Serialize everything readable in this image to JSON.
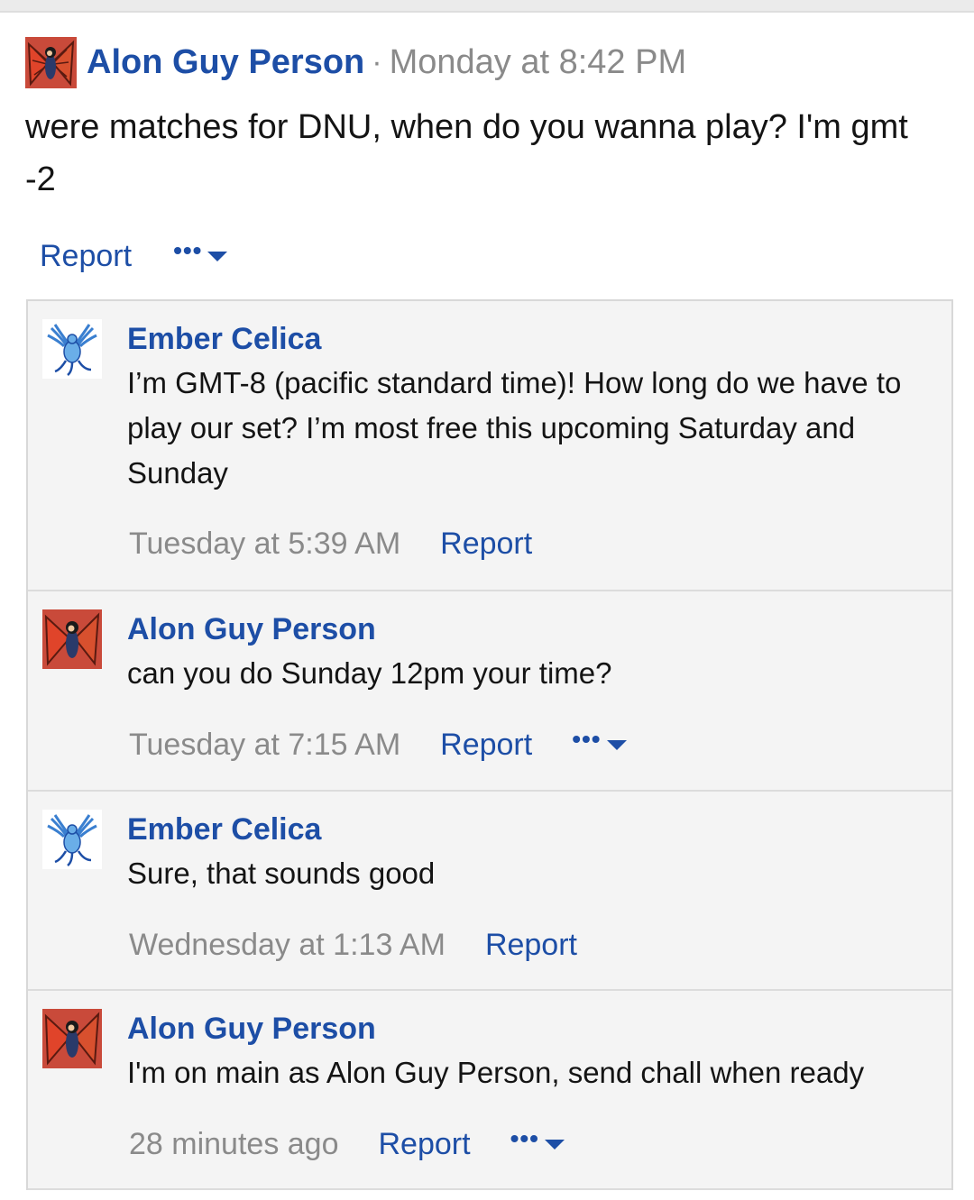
{
  "post": {
    "author": "Alon Guy Person",
    "separator": "·",
    "time": "Monday at 8:42 PM",
    "body": "were matches for DNU, when do you wanna play? I'm gmt -2",
    "report_label": "Report",
    "more_dots": "•••"
  },
  "comments": [
    {
      "author": "Ember Celica",
      "text": "I’m GMT-8 (pacific standard time)! How long do we have to play our set? I’m most free this upcoming Saturday and Sunday",
      "time": "Tuesday at 5:39 AM",
      "report_label": "Report"
    },
    {
      "author": "Alon Guy Person",
      "text": "can you do Sunday 12pm your time?",
      "time": "Tuesday at 7:15 AM",
      "report_label": "Report",
      "more_dots": "•••"
    },
    {
      "author": "Ember Celica",
      "text": "Sure, that sounds good",
      "time": "Wednesday at 1:13 AM",
      "report_label": "Report"
    },
    {
      "author": "Alon Guy Person",
      "text": "I'm on main as Alon Guy Person, send chall when ready",
      "time": "28 minutes ago",
      "report_label": "Report",
      "more_dots": "•••"
    }
  ],
  "colors": {
    "link": "#1d4ea6",
    "muted": "#8a8a8a",
    "comment_bg": "#f4f4f4"
  },
  "icons": {
    "alon_avatar": "butterfly-avatar-icon",
    "ember_avatar": "bird-avatar-icon",
    "more": "ellipsis-icon",
    "caret": "chevron-down-icon"
  }
}
